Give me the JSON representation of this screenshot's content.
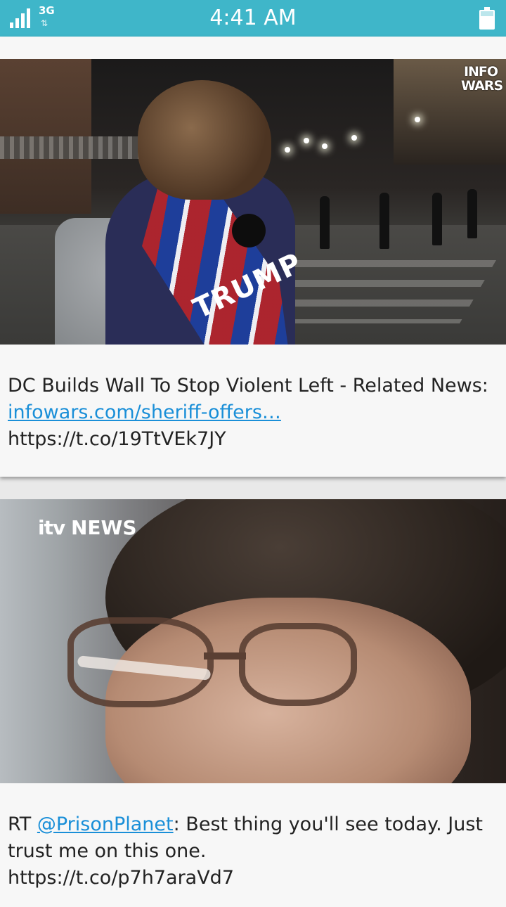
{
  "status_bar": {
    "network": "3G",
    "network_arrows": "⇅",
    "time": "4:41 AM",
    "signal_icon": "signal-bars-icon",
    "battery_icon": "battery-icon",
    "accent_color": "#3fb6c9"
  },
  "feed": {
    "items": [
      {
        "image_watermark_line1": "INFO",
        "image_watermark_line2": "WARS",
        "image_scarf_text": "TRUMP",
        "text_prefix": "DC Builds Wall To Stop Violent Left - Related News: ",
        "link": "infowars.com/sheriff-offers…",
        "text_suffix": "https://t.co/19TtVEk7JY"
      },
      {
        "image_watermark_brand": "itv",
        "image_watermark_label": "NEWS",
        "text_prefix": "RT ",
        "mention": "@PrisonPlanet",
        "text_middle": ": Best thing you'll see today. Just trust me on this one.",
        "text_suffix": "https://t.co/p7h7araVd7"
      }
    ],
    "link_color": "#1a8fd8"
  }
}
